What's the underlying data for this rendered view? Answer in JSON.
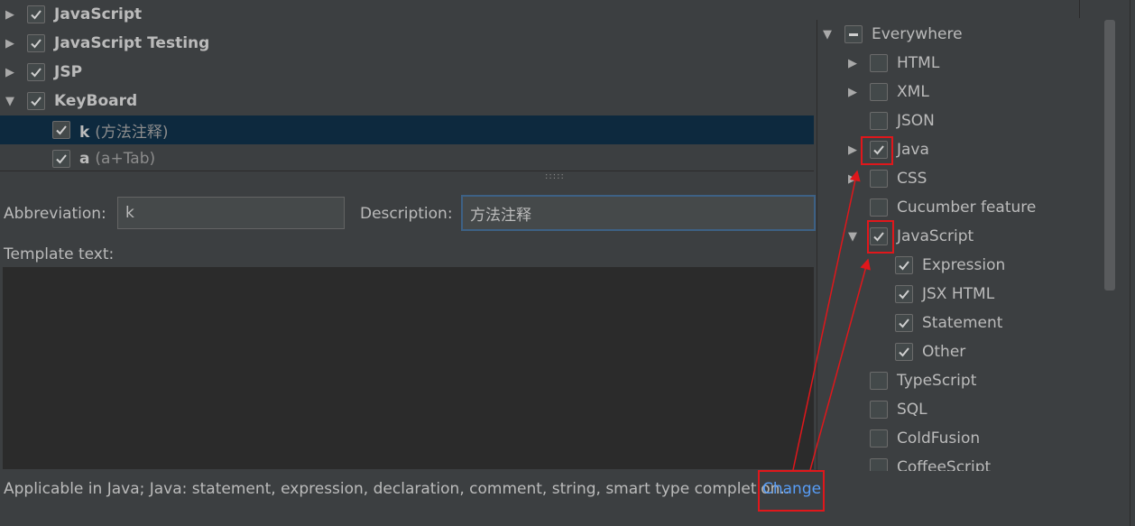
{
  "tree": [
    {
      "arrow": "right",
      "checked": true,
      "label": "JavaScript",
      "sub": ""
    },
    {
      "arrow": "right",
      "checked": true,
      "label": "JavaScript Testing",
      "sub": ""
    },
    {
      "arrow": "right",
      "checked": true,
      "label": "JSP",
      "sub": ""
    },
    {
      "arrow": "down",
      "checked": true,
      "label": "KeyBoard",
      "sub": ""
    },
    {
      "arrow": "",
      "checked": true,
      "label": "k",
      "sub": "(方法注释)",
      "selected": true
    },
    {
      "arrow": "",
      "checked": true,
      "label": "a",
      "sub": "(a+Tab)"
    }
  ],
  "form": {
    "abbreviation_label": "Abbreviation:",
    "abbreviation_value": "k",
    "description_label": "Description:",
    "description_value": "方法注释",
    "template_label": "Template text:"
  },
  "footer": {
    "applicable_text": "Applicable in Java; Java: statement, expression, declaration, comment, string, smart type completion..",
    "change_link": "Change"
  },
  "contexts": [
    {
      "arrow": "down",
      "state": "partial",
      "label": "Everywhere",
      "indent": 0
    },
    {
      "arrow": "right",
      "state": "unchecked",
      "label": "HTML",
      "indent": 1
    },
    {
      "arrow": "right",
      "state": "unchecked",
      "label": "XML",
      "indent": 1
    },
    {
      "arrow": "",
      "state": "unchecked",
      "label": "JSON",
      "indent": 1
    },
    {
      "arrow": "right",
      "state": "checked",
      "label": "Java",
      "indent": 1
    },
    {
      "arrow": "right",
      "state": "unchecked",
      "label": "CSS",
      "indent": 1
    },
    {
      "arrow": "",
      "state": "unchecked",
      "label": "Cucumber feature",
      "indent": 1
    },
    {
      "arrow": "down",
      "state": "checked",
      "label": "JavaScript",
      "indent": 1
    },
    {
      "arrow": "",
      "state": "checked",
      "label": "Expression",
      "indent": 2
    },
    {
      "arrow": "",
      "state": "checked",
      "label": "JSX HTML",
      "indent": 2
    },
    {
      "arrow": "",
      "state": "checked",
      "label": "Statement",
      "indent": 2
    },
    {
      "arrow": "",
      "state": "checked",
      "label": "Other",
      "indent": 2
    },
    {
      "arrow": "",
      "state": "unchecked",
      "label": "TypeScript",
      "indent": 1
    },
    {
      "arrow": "",
      "state": "unchecked",
      "label": "SQL",
      "indent": 1
    },
    {
      "arrow": "",
      "state": "unchecked",
      "label": "ColdFusion",
      "indent": 1
    },
    {
      "arrow": "",
      "state": "unchecked",
      "label": "CoffeeScript",
      "indent": 1
    }
  ],
  "colors": {
    "accent": "#589df6",
    "annotation": "#e0171b",
    "selection": "#0d293e"
  }
}
